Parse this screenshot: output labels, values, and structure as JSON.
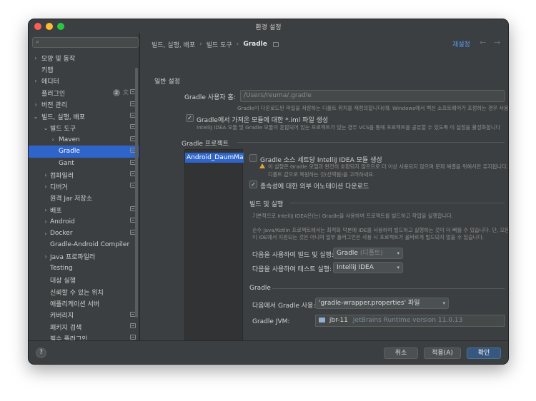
{
  "window": {
    "title": "환경 설정"
  },
  "search": {
    "placeholder": ""
  },
  "sidebar": {
    "items": [
      {
        "label": "모양 및 동작",
        "chevron": "›",
        "indent": 0
      },
      {
        "label": "키맵",
        "chevron": "",
        "indent": 0
      },
      {
        "label": "에디터",
        "chevron": "›",
        "indent": 0
      },
      {
        "label": "플러그인",
        "chevron": "",
        "indent": 0,
        "badge": "2"
      },
      {
        "label": "버전 관리",
        "chevron": "›",
        "indent": 0
      },
      {
        "label": "빌드, 실행, 배포",
        "chevron": "⌄",
        "indent": 0
      },
      {
        "label": "빌드 도구",
        "chevron": "⌄",
        "indent": 1
      },
      {
        "label": "Maven",
        "chevron": "›",
        "indent": 2
      },
      {
        "label": "Gradle",
        "chevron": "",
        "indent": 2,
        "selected": true
      },
      {
        "label": "Gant",
        "chevron": "",
        "indent": 2
      },
      {
        "label": "컴파일러",
        "chevron": "›",
        "indent": 1
      },
      {
        "label": "디버거",
        "chevron": "›",
        "indent": 1
      },
      {
        "label": "원격 Jar 저장소",
        "chevron": "",
        "indent": 1
      },
      {
        "label": "배포",
        "chevron": "›",
        "indent": 1
      },
      {
        "label": "Android",
        "chevron": "›",
        "indent": 1
      },
      {
        "label": "Docker",
        "chevron": "›",
        "indent": 1
      },
      {
        "label": "Gradle-Android Compiler",
        "chevron": "",
        "indent": 1
      },
      {
        "label": "Java 프로파일러",
        "chevron": "›",
        "indent": 1
      },
      {
        "label": "Testing",
        "chevron": "",
        "indent": 1
      },
      {
        "label": "대상 실행",
        "chevron": "",
        "indent": 1
      },
      {
        "label": "신뢰할 수 있는 위치",
        "chevron": "",
        "indent": 1
      },
      {
        "label": "애플리케이션 서버",
        "chevron": "",
        "indent": 1
      },
      {
        "label": "커버리지",
        "chevron": "",
        "indent": 1
      },
      {
        "label": "패키지 검색",
        "chevron": "",
        "indent": 1
      },
      {
        "label": "필수 플러그인",
        "chevron": "",
        "indent": 1
      }
    ]
  },
  "breadcrumb": {
    "part1": "빌드, 실행, 배포",
    "sep": "›",
    "part2": "빌드 도구",
    "current": "Gradle"
  },
  "header": {
    "reset": "재설정",
    "back": "←",
    "forward": "→"
  },
  "general": {
    "title": "일반 설정",
    "home_label": "Gradle 사용자 홈:",
    "home_value": "/Users/reuma/.gradle",
    "home_hint": "Gradle이 다운로드된 파일을 저장하는 디폴트 위치를 재정의합니다(예: Windows에서 백신 소프트웨어가 조정하는 경우 사용)",
    "iml_label": "Gradle에서 가져온 모듈에 대한 *.iml 파일 생성",
    "iml_hint": "IntelliJ IDEA 모듈 및 Gradle 모듈이 혼합되어 있는 프로젝트가 있는 경우 VCS를 통해 프로젝트를 공유할 수 있도록 이 설정을 활성화합니다"
  },
  "projects": {
    "title": "Gradle 프로젝트",
    "selected": "Android_DaumMap"
  },
  "project_settings": {
    "source_sets_label": "Gradle 소스 세트당 IntelliJ IDEA 모듈 생성",
    "warn_line1": "이 설정은 Gradle 모델과 완전히 호환되지 않으므로 더 이상 사용되지 않으며 문제 해결을 위해서만 유지됩니다.",
    "warn_line2": "디폴트 값으로 복원하는 것(선택됨)을 고려하세요.",
    "annotations_label": "종속성에 대한 외부 어노테이션 다운로드"
  },
  "build_run": {
    "title": "빌드 및 실행",
    "desc1": "기본적으로 IntelliJ IDEA은(는) Gradle을 사용하여 프로젝트를 빌드하고 작업을 실행합니다.",
    "desc2": "순수 Java/Kotlin 프로젝트에서는 최적화 덕분에 IDE를 사용하여 빌드하고 실행하는 것이 더 빠를 수 있습니다. 단, 모든 Gradle 플",
    "desc3": "이 IDE에서 지원되는 것은 아니며 일부 플러그인은 사용 시 프로젝트가 올바르게 빌드되지 않을 수 있습니다.",
    "build_label": "다음을 사용하여 빌드 및 실행:",
    "build_value": "Gradle",
    "build_suffix": "(디폴트)",
    "test_label": "다음을 사용하여 테스트 실행:",
    "test_value": "IntelliJ IDEA"
  },
  "gradle": {
    "title": "Gradle",
    "use_label": "다음에서 Gradle 사용:",
    "use_value": "'gradle-wrapper.properties' 파일",
    "jvm_label": "Gradle JVM:",
    "jvm_name": "jbr-11",
    "jvm_desc": "JetBrains Runtime version 11.0.13"
  },
  "footer": {
    "help": "?",
    "cancel": "취소",
    "apply": "적용(A)",
    "ok": "확인"
  },
  "colors": {
    "accent": "#2f65ca",
    "link": "#589df6",
    "warning": "#e3a33b",
    "primary_button": "#365880"
  }
}
